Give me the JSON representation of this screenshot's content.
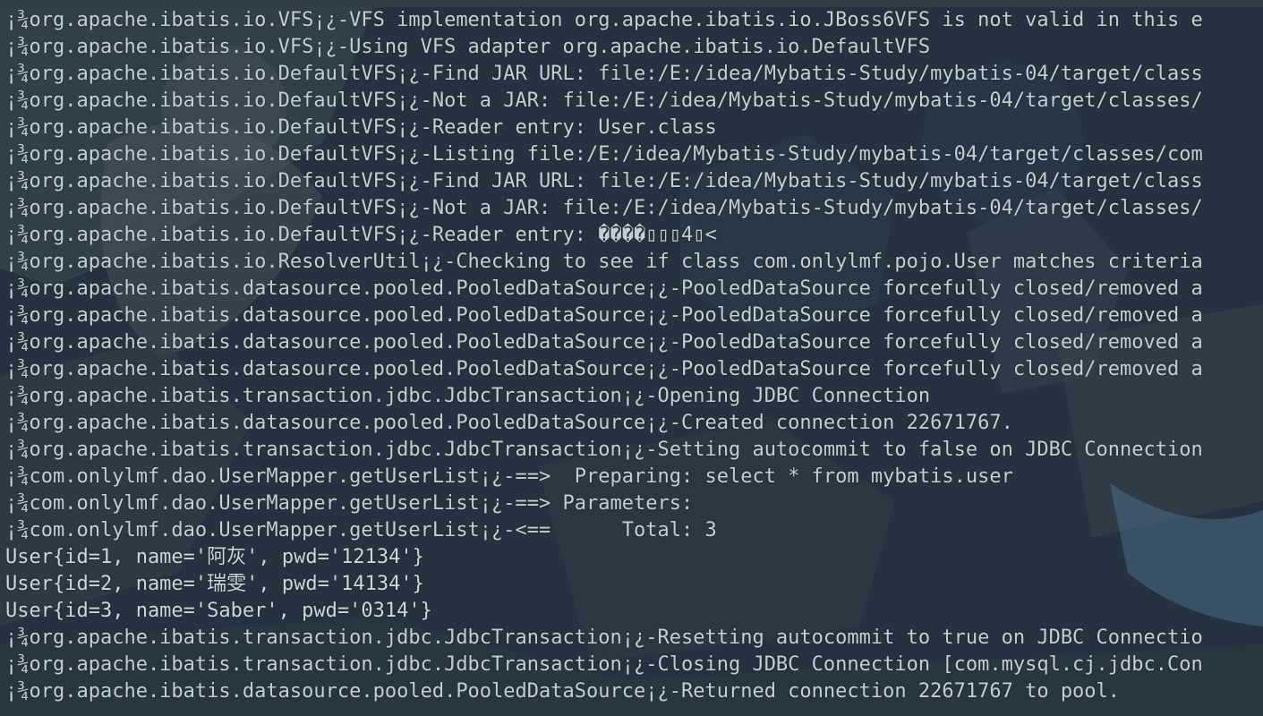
{
  "console": {
    "lines": [
      "¡¾org.apache.ibatis.io.VFS¡¿-VFS implementation org.apache.ibatis.io.JBoss6VFS is not valid in this e",
      "¡¾org.apache.ibatis.io.VFS¡¿-Using VFS adapter org.apache.ibatis.io.DefaultVFS",
      "¡¾org.apache.ibatis.io.DefaultVFS¡¿-Find JAR URL: file:/E:/idea/Mybatis-Study/mybatis-04/target/class",
      "¡¾org.apache.ibatis.io.DefaultVFS¡¿-Not a JAR: file:/E:/idea/Mybatis-Study/mybatis-04/target/classes/",
      "¡¾org.apache.ibatis.io.DefaultVFS¡¿-Reader entry: User.class",
      "¡¾org.apache.ibatis.io.DefaultVFS¡¿-Listing file:/E:/idea/Mybatis-Study/mybatis-04/target/classes/com",
      "¡¾org.apache.ibatis.io.DefaultVFS¡¿-Find JAR URL: file:/E:/idea/Mybatis-Study/mybatis-04/target/class",
      "¡¾org.apache.ibatis.io.DefaultVFS¡¿-Not a JAR: file:/E:/idea/Mybatis-Study/mybatis-04/target/classes/",
      "¡¾org.apache.ibatis.io.DefaultVFS¡¿-Reader entry: ����▯▯▯4▯<",
      "¡¾org.apache.ibatis.io.ResolverUtil¡¿-Checking to see if class com.onlylmf.pojo.User matches criteria",
      "¡¾org.apache.ibatis.datasource.pooled.PooledDataSource¡¿-PooledDataSource forcefully closed/removed a",
      "¡¾org.apache.ibatis.datasource.pooled.PooledDataSource¡¿-PooledDataSource forcefully closed/removed a",
      "¡¾org.apache.ibatis.datasource.pooled.PooledDataSource¡¿-PooledDataSource forcefully closed/removed a",
      "¡¾org.apache.ibatis.datasource.pooled.PooledDataSource¡¿-PooledDataSource forcefully closed/removed a",
      "¡¾org.apache.ibatis.transaction.jdbc.JdbcTransaction¡¿-Opening JDBC Connection",
      "¡¾org.apache.ibatis.datasource.pooled.PooledDataSource¡¿-Created connection 22671767.",
      "¡¾org.apache.ibatis.transaction.jdbc.JdbcTransaction¡¿-Setting autocommit to false on JDBC Connection",
      "¡¾com.onlylmf.dao.UserMapper.getUserList¡¿-==>  Preparing: select * from mybatis.user",
      "¡¾com.onlylmf.dao.UserMapper.getUserList¡¿-==> Parameters: ",
      "¡¾com.onlylmf.dao.UserMapper.getUserList¡¿-<==      Total: 3",
      "User{id=1, name='阿灰', pwd='12134'}",
      "User{id=2, name='瑞雯', pwd='14134'}",
      "User{id=3, name='Saber', pwd='0314'}",
      "¡¾org.apache.ibatis.transaction.jdbc.JdbcTransaction¡¿-Resetting autocommit to true on JDBC Connectio",
      "¡¾org.apache.ibatis.transaction.jdbc.JdbcTransaction¡¿-Closing JDBC Connection [com.mysql.cj.jdbc.Con",
      "¡¾org.apache.ibatis.datasource.pooled.PooledDataSource¡¿-Returned connection 22671767 to pool."
    ]
  },
  "colors": {
    "background": "#23323f",
    "text": "#c3ced6"
  }
}
